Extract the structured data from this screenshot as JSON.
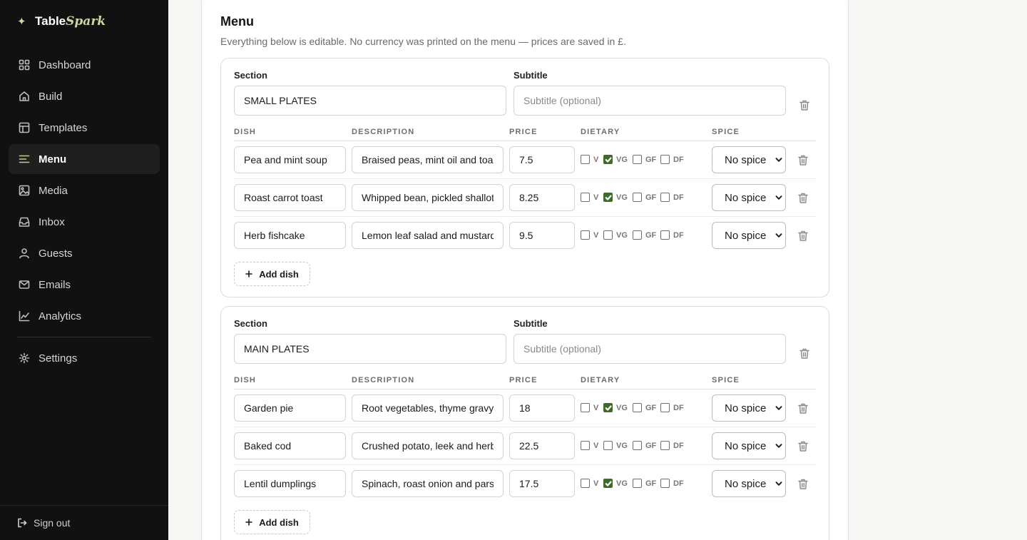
{
  "brand": {
    "name_a": "Table",
    "name_b": "Spark",
    "spark_glyph": "✦"
  },
  "nav": [
    {
      "label": "Dashboard",
      "icon": "grid-icon",
      "active": false
    },
    {
      "label": "Build",
      "icon": "home-icon",
      "active": false
    },
    {
      "label": "Templates",
      "icon": "layout-icon",
      "active": false
    },
    {
      "label": "Menu",
      "icon": "list-icon",
      "active": true
    },
    {
      "label": "Media",
      "icon": "image-icon",
      "active": false
    },
    {
      "label": "Inbox",
      "icon": "inbox-icon",
      "active": false
    },
    {
      "label": "Guests",
      "icon": "user-icon",
      "active": false
    },
    {
      "label": "Emails",
      "icon": "mail-icon",
      "active": false
    },
    {
      "label": "Analytics",
      "icon": "chart-icon",
      "active": false
    }
  ],
  "settings_label": "Settings",
  "signout_label": "Sign out",
  "menu": {
    "title": "Menu",
    "subtitle": "Everything below is editable. No currency was printed on the menu — prices are saved in £."
  },
  "labels": {
    "section": "Section",
    "subtitle": "Subtitle",
    "subtitle_placeholder": "Subtitle (optional)",
    "col_dish": "DISH",
    "col_description": "DESCRIPTION",
    "col_price": "PRICE",
    "col_dietary": "DIETARY",
    "col_spice": "SPICE",
    "add_dish": "Add dish",
    "diet_v": "V",
    "diet_vg": "VG",
    "diet_gf": "GF",
    "diet_df": "DF"
  },
  "sections": [
    {
      "name": "SMALL PLATES",
      "subtitle": "",
      "dishes": [
        {
          "name": "Pea and mint soup",
          "description": "Braised peas, mint oil and toast",
          "price": "7.5",
          "v": false,
          "vg": true,
          "gf": false,
          "df": false,
          "spice": "No spice"
        },
        {
          "name": "Roast carrot toast",
          "description": "Whipped bean, pickled shallot",
          "price": "8.25",
          "v": false,
          "vg": true,
          "gf": false,
          "df": false,
          "spice": "No spice"
        },
        {
          "name": "Herb fishcake",
          "description": "Lemon leaf salad and mustard",
          "price": "9.5",
          "v": false,
          "vg": false,
          "gf": false,
          "df": false,
          "spice": "No spice"
        }
      ]
    },
    {
      "name": "MAIN PLATES",
      "subtitle": "",
      "dishes": [
        {
          "name": "Garden pie",
          "description": "Root vegetables, thyme gravy",
          "price": "18",
          "v": false,
          "vg": true,
          "gf": false,
          "df": false,
          "spice": "No spice"
        },
        {
          "name": "Baked cod",
          "description": "Crushed potato, leek and herbs",
          "price": "22.5",
          "v": false,
          "vg": false,
          "gf": false,
          "df": false,
          "spice": "No spice"
        },
        {
          "name": "Lentil dumplings",
          "description": "Spinach, roast onion and parsley",
          "price": "17.5",
          "v": false,
          "vg": true,
          "gf": false,
          "df": false,
          "spice": "No spice"
        }
      ]
    }
  ],
  "colors": {
    "sidebar": "#111111",
    "accent": "#b9d08a",
    "check": "#3f6b2a"
  }
}
